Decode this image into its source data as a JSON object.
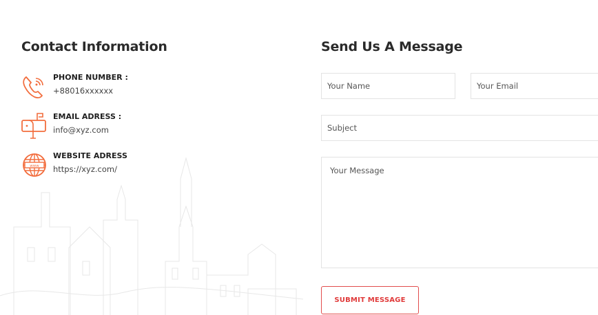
{
  "contact": {
    "title": "Contact Information",
    "items": [
      {
        "label": "PHONE NUMBER :",
        "value": "+88016xxxxxx",
        "icon": "phone-icon"
      },
      {
        "label": "EMAIL ADRESS :",
        "value": "info@xyz.com",
        "icon": "mailbox-icon"
      },
      {
        "label": "WEBSITE ADRESS",
        "value": "https://xyz.com/",
        "icon": "globe-icon"
      }
    ]
  },
  "form": {
    "title": "Send Us A Message",
    "name_placeholder": "Your Name",
    "email_placeholder": "Your Email",
    "subject_placeholder": "Subject",
    "message_placeholder": "Your Message",
    "submit_label": "SUBMIT MESSAGE"
  },
  "colors": {
    "accent": "#f26d3d",
    "button": "#e03a3a",
    "heading": "#2a2a2a"
  }
}
